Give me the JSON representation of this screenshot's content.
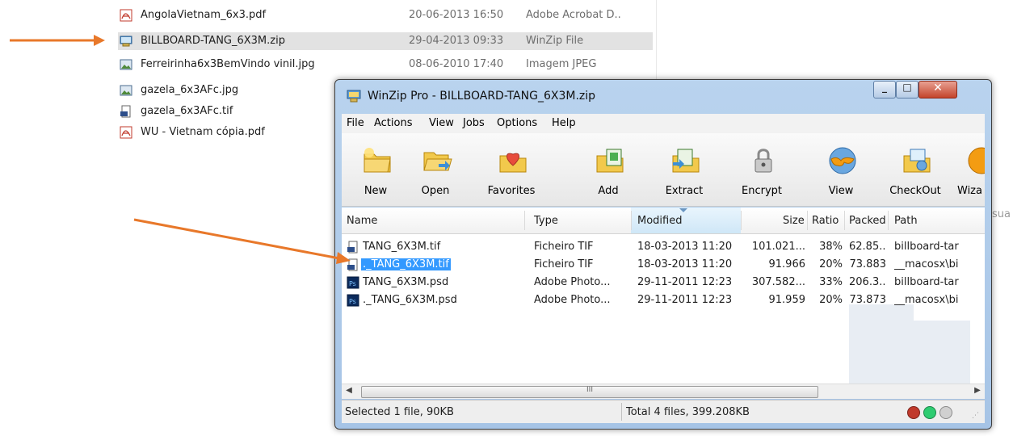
{
  "explorer": {
    "files": [
      {
        "name": "AngolaVietnam_6x3.pdf",
        "date": "20-06-2013 16:50",
        "type": "Adobe Acrobat D..",
        "icon": "pdf-icon"
      },
      {
        "name": "BILLBOARD-TANG_6X3M.zip",
        "date": "29-04-2013 09:33",
        "type": "WinZip File",
        "icon": "zip-icon"
      },
      {
        "name": "Ferreirinha6x3BemVindo vinil.jpg",
        "date": "08-06-2010 17:40",
        "type": "Imagem JPEG",
        "icon": "image-icon"
      },
      {
        "name": "gazela_6x3AFc.jpg",
        "date": "",
        "type": "",
        "icon": "image-icon"
      },
      {
        "name": "gazela_6x3AFc.tif",
        "date": "",
        "type": "",
        "icon": "tif-icon"
      },
      {
        "name": "WU - Vietnam cópia.pdf",
        "date": "",
        "type": "",
        "icon": "pdf-icon"
      }
    ],
    "right_text": "sua"
  },
  "winzip": {
    "title": "WinZip Pro - BILLBOARD-TANG_6X3M.zip",
    "menu": [
      "File",
      "Actions",
      "View",
      "Jobs",
      "Options",
      "Help"
    ],
    "toolbar": [
      {
        "label": "New",
        "icon": "new-archive-icon"
      },
      {
        "label": "Open",
        "icon": "open-folder-icon"
      },
      {
        "label": "Favorites",
        "icon": "favorites-heart-icon"
      },
      {
        "label": "Add",
        "icon": "add-files-icon"
      },
      {
        "label": "Extract",
        "icon": "extract-icon"
      },
      {
        "label": "Encrypt",
        "icon": "encrypt-lock-icon"
      },
      {
        "label": "View",
        "icon": "view-glasses-icon"
      },
      {
        "label": "CheckOut",
        "icon": "checkout-icon"
      },
      {
        "label": "Wiza",
        "icon": "wizard-icon"
      }
    ],
    "columns": [
      "Name",
      "Type",
      "Modified",
      "Size",
      "Ratio",
      "Packed",
      "Path"
    ],
    "rows": [
      {
        "name": "TANG_6X3M.tif",
        "type": "Ficheiro TIF",
        "modified": "18-03-2013 11:20",
        "size": "101.021...",
        "ratio": "38%",
        "packed": "62.85...",
        "path": "billboard-tar",
        "icon": "tif-icon",
        "selected": false
      },
      {
        "name": "._TANG_6X3M.tif",
        "type": "Ficheiro TIF",
        "modified": "18-03-2013 11:20",
        "size": "91.966",
        "ratio": "20%",
        "packed": "73.883",
        "path": "__macosx\\bi",
        "icon": "tif-icon",
        "selected": true
      },
      {
        "name": "TANG_6X3M.psd",
        "type": "Adobe Photo...",
        "modified": "29-11-2011 12:23",
        "size": "307.582...",
        "ratio": "33%",
        "packed": "206.3...",
        "path": "billboard-tar",
        "icon": "psd-icon",
        "selected": false
      },
      {
        "name": "._TANG_6X3M.psd",
        "type": "Adobe Photo...",
        "modified": "29-11-2011 12:23",
        "size": "91.959",
        "ratio": "20%",
        "packed": "73.873",
        "path": "__macosx\\bi",
        "icon": "psd-icon",
        "selected": false
      }
    ],
    "scroll_grip": "III",
    "status_left": "Selected 1 file, 90KB",
    "status_right": "Total 4 files, 399.208KB"
  },
  "colors": {
    "arrow": "#e8782a",
    "selection": "#3399ff",
    "title_bar": "#b9d3ee"
  }
}
